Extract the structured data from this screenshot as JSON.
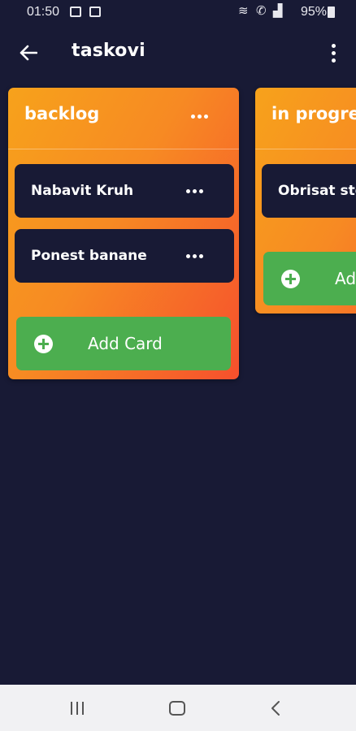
{
  "status_bar": {
    "time": "01:50",
    "battery": "95%"
  },
  "app_bar": {
    "title": "taskovi"
  },
  "columns": [
    {
      "title": "backlog",
      "cards": [
        {
          "title": "Nabavit Kruh"
        },
        {
          "title": "Ponest banane"
        }
      ],
      "add_label": "Add Card"
    },
    {
      "title": "in progre",
      "cards": [
        {
          "title": "Obrisat ste"
        }
      ],
      "add_label": "Ad"
    }
  ],
  "colors": {
    "background": "#181a35",
    "column_gradient_start": "#f7a21b",
    "column_gradient_end": "#f6502d",
    "add_button": "#4cae4f"
  }
}
